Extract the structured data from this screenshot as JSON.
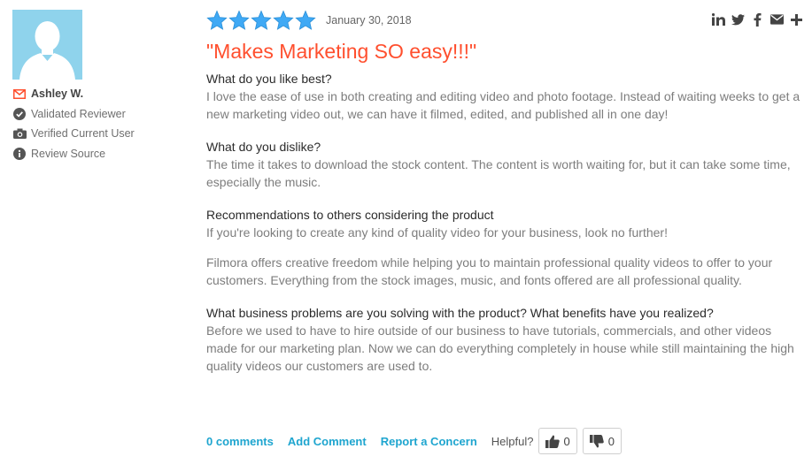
{
  "reviewer": {
    "name": "Ashley W.",
    "badges": [
      {
        "icon": "envelope-icon",
        "label": "Ashley W."
      },
      {
        "icon": "check-circle-icon",
        "label": "Validated Reviewer"
      },
      {
        "icon": "camera-icon",
        "label": "Verified Current User"
      },
      {
        "icon": "info-icon",
        "label": "Review Source"
      }
    ]
  },
  "review": {
    "rating": 5,
    "date": "January 30, 2018",
    "title": "\"Makes Marketing SO easy!!!\"",
    "sections": [
      {
        "question": "What do you like best?",
        "answers": [
          "I love the ease of use in both creating and editing video and photo footage. Instead of waiting weeks to get a new marketing video out, we can have it filmed, edited, and published all in one day!"
        ]
      },
      {
        "question": "What do you dislike?",
        "answers": [
          "The time it takes to download the stock content. The content is worth waiting for, but it can take some time, especially the music."
        ]
      },
      {
        "question": "Recommendations to others considering the product",
        "answers": [
          "If you're looking to create any kind of quality video for your business, look no further!",
          "Filmora offers creative freedom while helping you to maintain professional quality videos to offer to your customers. Everything from the stock images, music, and fonts offered are all professional quality."
        ]
      },
      {
        "question": "What business problems are you solving with the product? What benefits have you realized?",
        "answers": [
          "Before we used to have to hire outside of our business to have tutorials, commercials, and other videos made for our marketing plan. Now we can do everything completely in house while still maintaining the high quality videos our customers are used to."
        ]
      }
    ]
  },
  "share": [
    "linkedin-icon",
    "twitter-icon",
    "facebook-icon",
    "email-icon",
    "plus-icon"
  ],
  "actions": {
    "comments": "0 comments",
    "add_comment": "Add Comment",
    "report": "Report a Concern",
    "helpful": "Helpful?",
    "upvotes": "0",
    "downvotes": "0"
  },
  "colors": {
    "star": "#3fa9f5",
    "title": "#ff4f2e",
    "link": "#1ea5cf",
    "avatar_bg": "#8fd3ec",
    "envelope": "#ff4f2e"
  }
}
